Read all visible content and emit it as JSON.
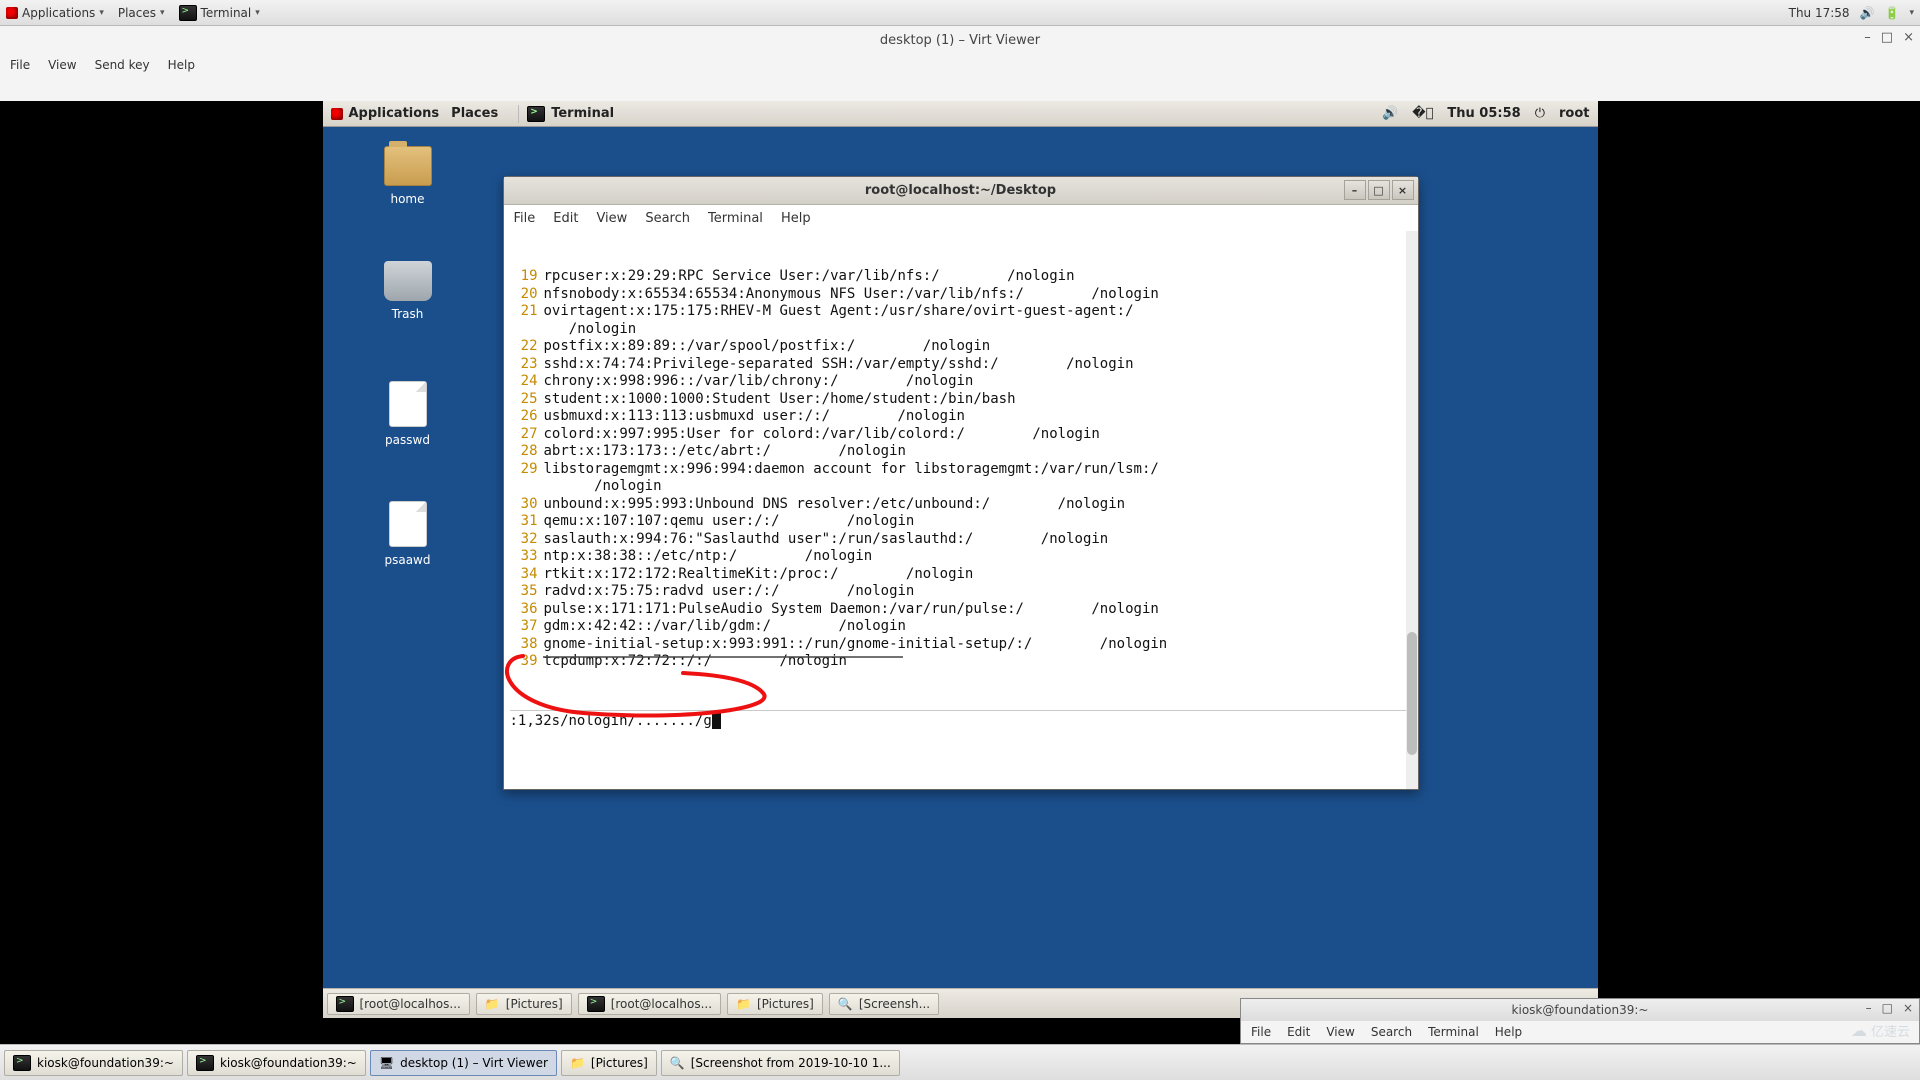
{
  "host_top": {
    "applications": "Applications",
    "places": "Places",
    "terminal": "Terminal",
    "clock": "Thu 17:58"
  },
  "virt": {
    "title": "desktop (1) – Virt Viewer",
    "menu": {
      "file": "File",
      "view": "View",
      "sendkey": "Send key",
      "help": "Help"
    }
  },
  "guest_panel": {
    "applications": "Applications",
    "places": "Places",
    "terminal": "Terminal",
    "clock": "Thu 05:58",
    "user": "root"
  },
  "desktop_icons": {
    "home": "home",
    "trash": "Trash",
    "passwd": "passwd",
    "psaawd": "psaawd"
  },
  "term": {
    "title": "root@localhost:~/Desktop",
    "menu": {
      "file": "File",
      "edit": "Edit",
      "view": "View",
      "search": "Search",
      "terminal": "Terminal",
      "help": "Help"
    },
    "lines": [
      {
        "n": "19",
        "t": "rpcuser:x:29:29:RPC Service User:/var/lib/nfs:/        /nologin"
      },
      {
        "n": "20",
        "t": "nfsnobody:x:65534:65534:Anonymous NFS User:/var/lib/nfs:/        /nologin"
      },
      {
        "n": "21",
        "t": "ovirtagent:x:175:175:RHEV-M Guest Agent:/usr/share/ovirt-guest-agent:/"
      },
      {
        "n": "",
        "t": "   /nologin"
      },
      {
        "n": "22",
        "t": "postfix:x:89:89::/var/spool/postfix:/        /nologin"
      },
      {
        "n": "23",
        "t": "sshd:x:74:74:Privilege-separated SSH:/var/empty/sshd:/        /nologin"
      },
      {
        "n": "24",
        "t": "chrony:x:998:996::/var/lib/chrony:/        /nologin"
      },
      {
        "n": "25",
        "t": "student:x:1000:1000:Student User:/home/student:/bin/bash"
      },
      {
        "n": "26",
        "t": "usbmuxd:x:113:113:usbmuxd user:/:/        /nologin"
      },
      {
        "n": "27",
        "t": "colord:x:997:995:User for colord:/var/lib/colord:/        /nologin"
      },
      {
        "n": "28",
        "t": "abrt:x:173:173::/etc/abrt:/        /nologin"
      },
      {
        "n": "29",
        "t": "libstoragemgmt:x:996:994:daemon account for libstoragemgmt:/var/run/lsm:/"
      },
      {
        "n": "",
        "t": "      /nologin"
      },
      {
        "n": "30",
        "t": "unbound:x:995:993:Unbound DNS resolver:/etc/unbound:/        /nologin"
      },
      {
        "n": "31",
        "t": "qemu:x:107:107:qemu user:/:/        /nologin"
      },
      {
        "n": "32",
        "t": "saslauth:x:994:76:\"Saslauthd user\":/run/saslauthd:/        /nologin"
      },
      {
        "n": "33",
        "t": "ntp:x:38:38::/etc/ntp:/        /nologin"
      },
      {
        "n": "34",
        "t": "rtkit:x:172:172:RealtimeKit:/proc:/        /nologin"
      },
      {
        "n": "35",
        "t": "radvd:x:75:75:radvd user:/:/        /nologin"
      },
      {
        "n": "36",
        "t": "pulse:x:171:171:PulseAudio System Daemon:/var/run/pulse:/        /nologin"
      },
      {
        "n": "37",
        "t": "gdm:x:42:42::/var/lib/gdm:/        /nologin"
      },
      {
        "n": "38",
        "t": "gnome-initial-setup:x:993:991::/run/gnome-initial-setup/:/        /nologin"
      },
      {
        "n": "39",
        "t": "tcpdump:x:72:72::/:/        /nologin"
      }
    ],
    "status": ":1,32s/nologin/......./g"
  },
  "guest_taskbar": {
    "items": [
      "[root@localhos...",
      "[Pictures]",
      "[root@localhos...",
      "[Pictures]",
      "[Screensh..."
    ]
  },
  "float_term": {
    "title": "kiosk@foundation39:~",
    "menu": {
      "file": "File",
      "edit": "Edit",
      "view": "View",
      "search": "Search",
      "terminal": "Terminal",
      "help": "Help"
    }
  },
  "host_taskbar": {
    "items": [
      "kiosk@foundation39:~",
      "kiosk@foundation39:~",
      "desktop (1) – Virt Viewer",
      "[Pictures]",
      "[Screenshot from 2019-10-10 1..."
    ],
    "active_index": 2
  },
  "watermark": "亿速云"
}
